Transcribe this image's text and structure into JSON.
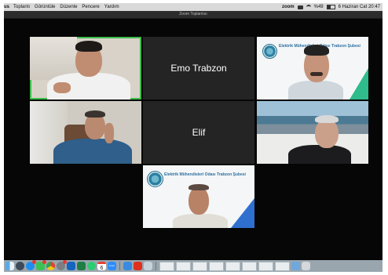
{
  "menubar": {
    "app_name": "us",
    "items": [
      "Toplantı",
      "Görüntüle",
      "Düzenle",
      "Pencere",
      "Yardım"
    ],
    "status_app": "zoom",
    "battery": "%49",
    "datetime": "6 Haziran Cat 20:47"
  },
  "window": {
    "title": "Zoom Toplantısı"
  },
  "participants": [
    {
      "type": "video",
      "speaking": true
    },
    {
      "type": "name",
      "name": "Emo Trabzon"
    },
    {
      "type": "video",
      "banner": "Elektrik Mühendisleri Odası Trabzon Şubesi"
    },
    {
      "type": "video"
    },
    {
      "type": "name",
      "name": "Elif"
    },
    {
      "type": "video"
    },
    {
      "type": "video",
      "banner": "Elektrik Mühendisleri Odası Trabzon Şubesi"
    }
  ],
  "dock": {
    "icons": [
      "finder-icon",
      "launchpad-icon",
      "app-store-icon",
      "messages-icon",
      "chrome-icon",
      "system-preferences-icon",
      "outlook-icon",
      "excel-icon",
      "whatsapp-icon",
      "calendar-icon",
      "zoom-icon",
      "keynote-icon",
      "acrobat-icon",
      "preview-icon",
      "downloads-icon",
      "trash-icon"
    ],
    "calendar_day": "6",
    "zoom_label": "zoom",
    "colors": {
      "accent_active_speaker": "#3dbd4c",
      "badge": "#e6372c"
    }
  }
}
